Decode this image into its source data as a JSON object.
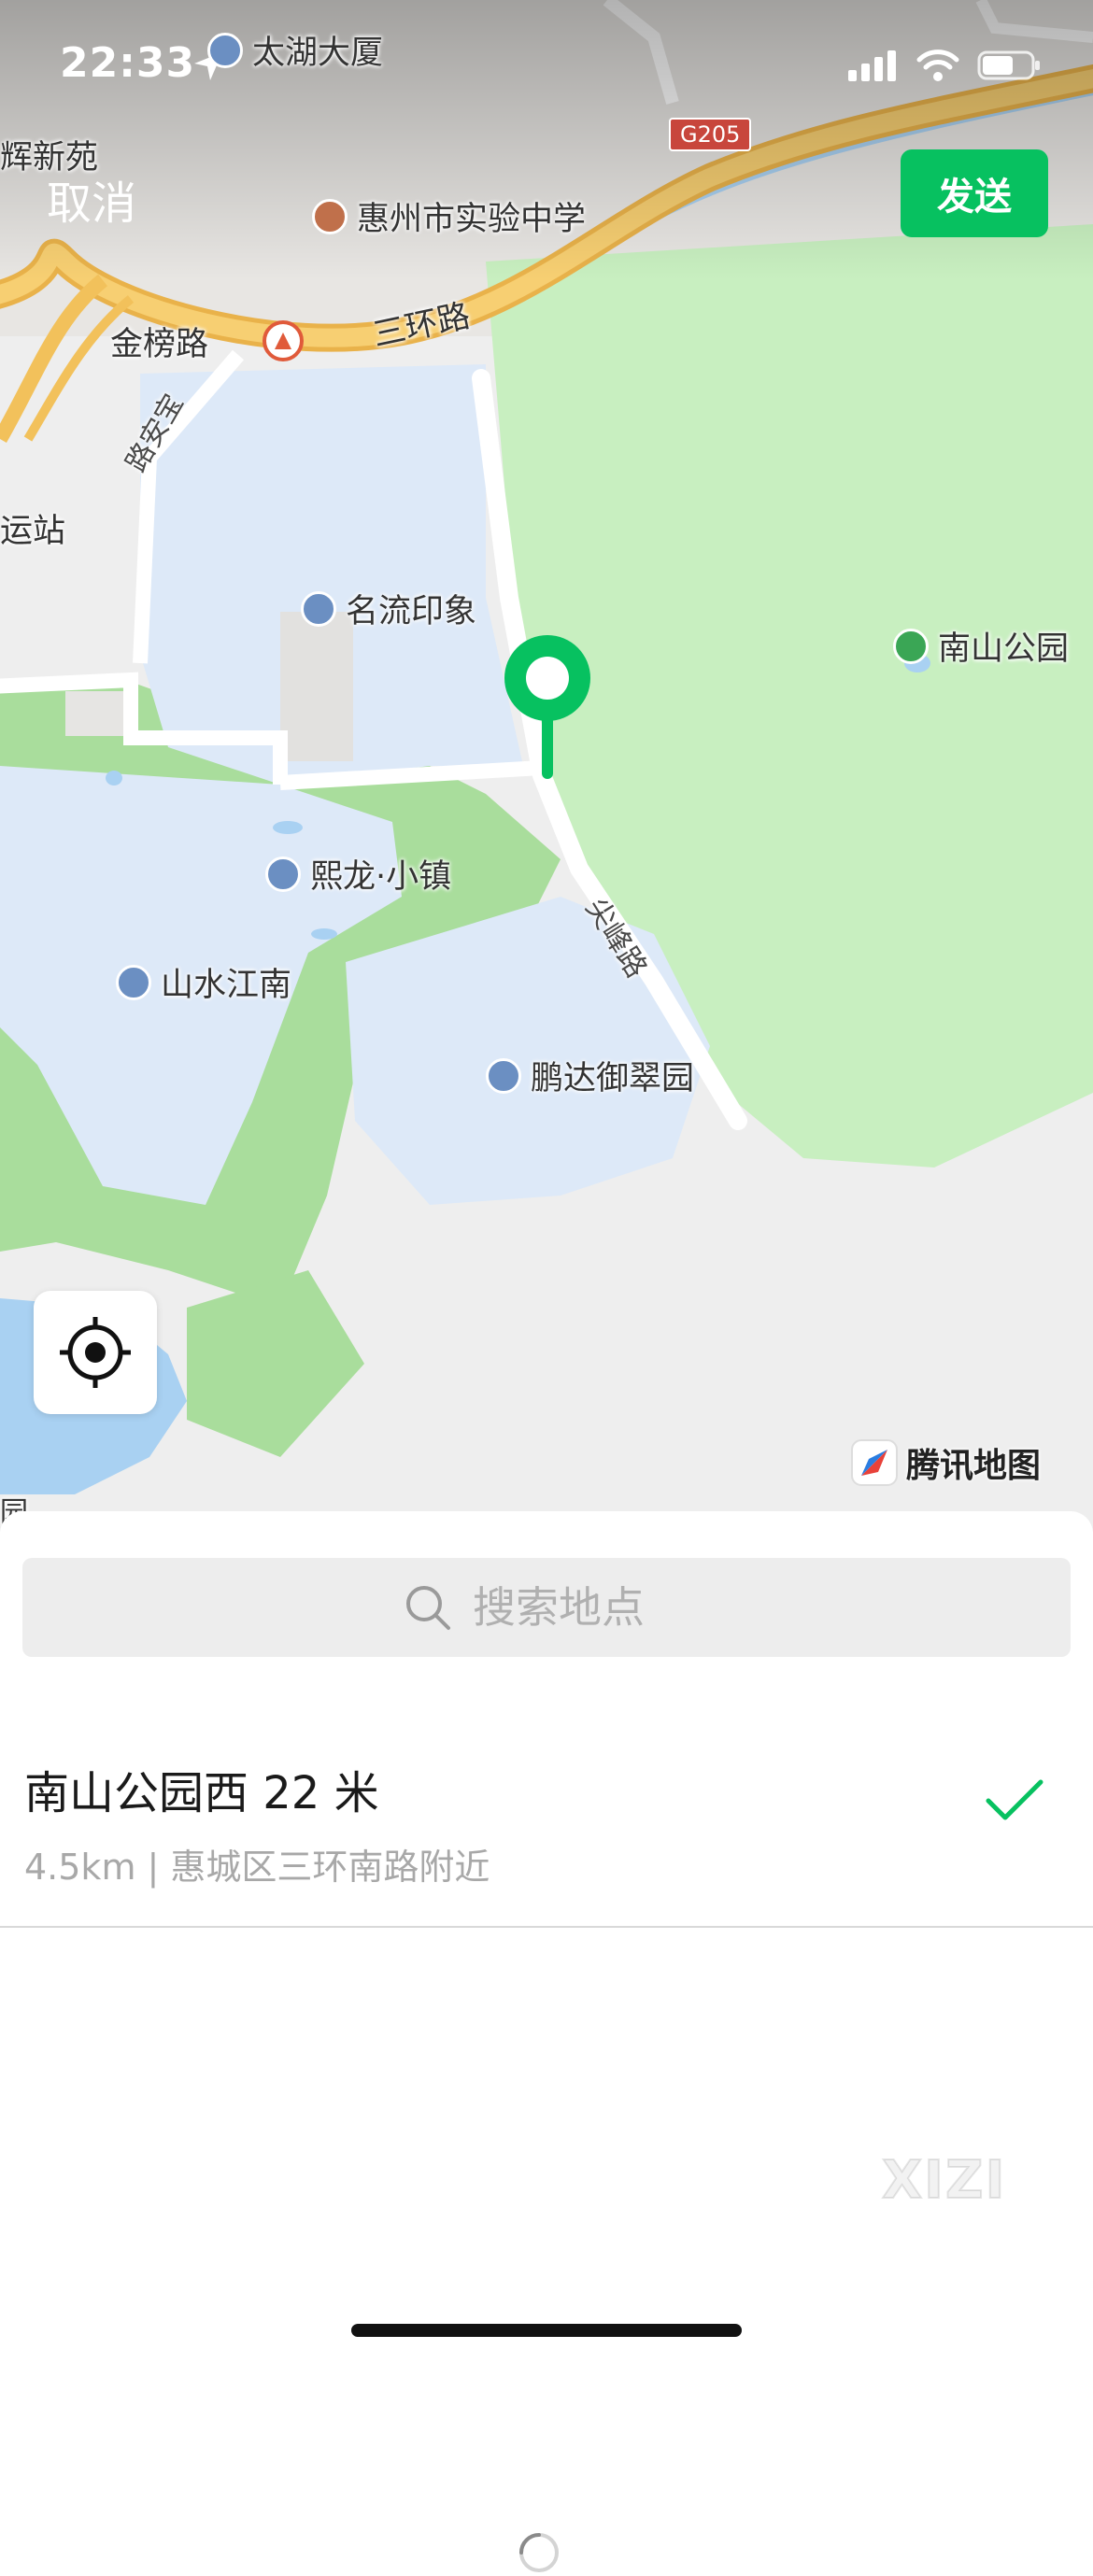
{
  "status": {
    "time": "22:33"
  },
  "header": {
    "cancel_label": "取消",
    "send_label": "发送"
  },
  "map": {
    "highway_shield": "G205",
    "brand": "腾讯地图",
    "labels": {
      "taihu_building": "太湖大厦",
      "huixinyuan": "辉新苑",
      "school": "惠州市实验中学",
      "jinbang_road": "金榜路",
      "sanhuan_road": "三环路",
      "side_road": "路安宝",
      "station": "运站",
      "mingliu": "名流印象",
      "nanshan_park": "南山公园",
      "xilong": "熙龙·小镇",
      "shanshui": "山水江南",
      "jianfeng_road": "尖峰路",
      "pengda": "鹏达御翠园",
      "edge_yuan": "园"
    }
  },
  "search": {
    "placeholder": "搜索地点"
  },
  "result": {
    "name": "南山公园西 22 米",
    "address": "4.5km | 惠城区三环南路附近"
  },
  "watermark": "XIZI",
  "colors": {
    "accent": "#07c160",
    "map_park": "#c8efc0",
    "map_green": "#a9dd9c",
    "map_residential": "#dde9f8",
    "map_water": "#a9d1f2",
    "map_highway": "#f2c15b"
  }
}
